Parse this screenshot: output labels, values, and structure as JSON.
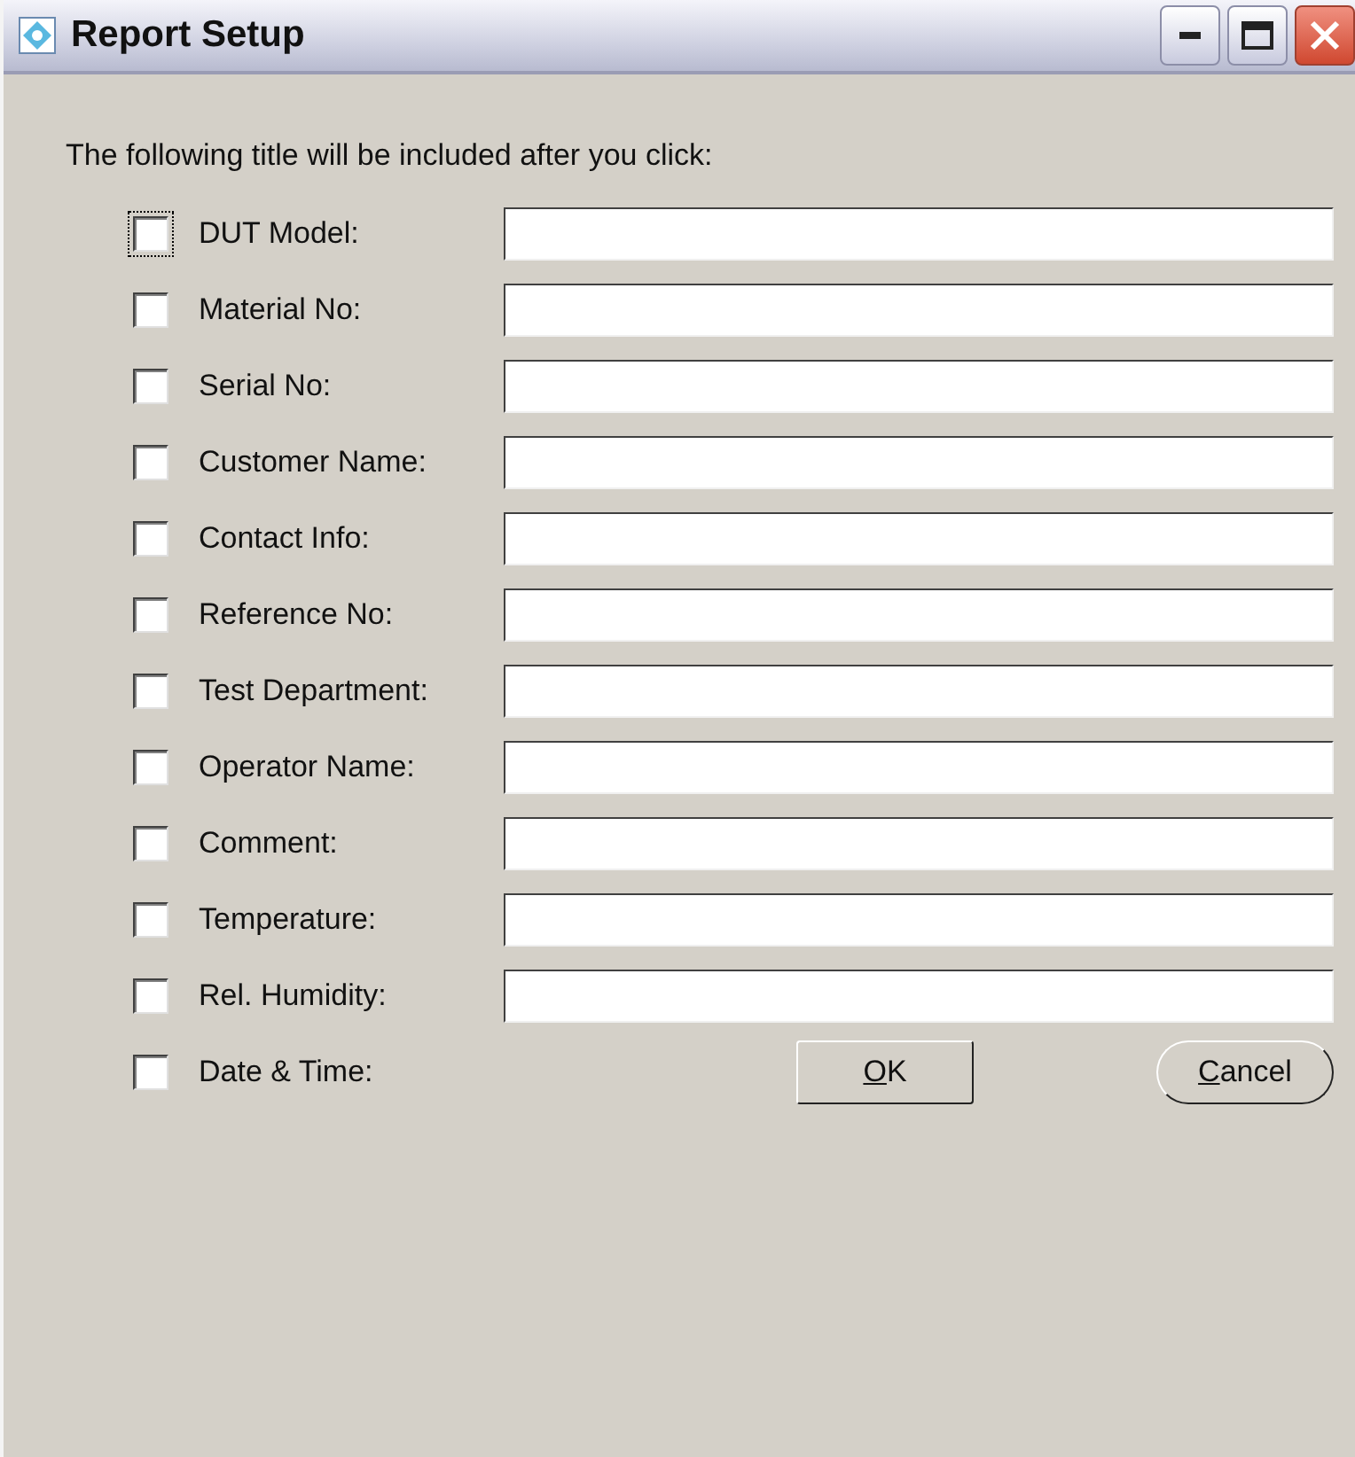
{
  "window": {
    "title": "Report Setup"
  },
  "prompt": "The following title will be included after you click:",
  "fields": [
    {
      "label": "DUT Model:",
      "checked": false,
      "focused": true
    },
    {
      "label": "Material No:",
      "checked": false,
      "focused": false
    },
    {
      "label": "Serial No:",
      "checked": false,
      "focused": false
    },
    {
      "label": "Customer Name:",
      "checked": false,
      "focused": false
    },
    {
      "label": "Contact Info:",
      "checked": false,
      "focused": false
    },
    {
      "label": "Reference No:",
      "checked": false,
      "focused": false
    },
    {
      "label": "Test Department:",
      "checked": false,
      "focused": false
    },
    {
      "label": "Operator Name:",
      "checked": false,
      "focused": false
    },
    {
      "label": "Comment:",
      "checked": false,
      "focused": false
    },
    {
      "label": "Temperature:",
      "checked": false,
      "focused": false
    },
    {
      "label": "Rel. Humidity:",
      "checked": false,
      "focused": false
    }
  ],
  "date_time": {
    "label": "Date & Time:",
    "checked": false,
    "focused": false
  },
  "buttons": [
    {
      "label": "OK",
      "kind": "square"
    },
    {
      "label": "Cancel",
      "kind": "round"
    }
  ]
}
